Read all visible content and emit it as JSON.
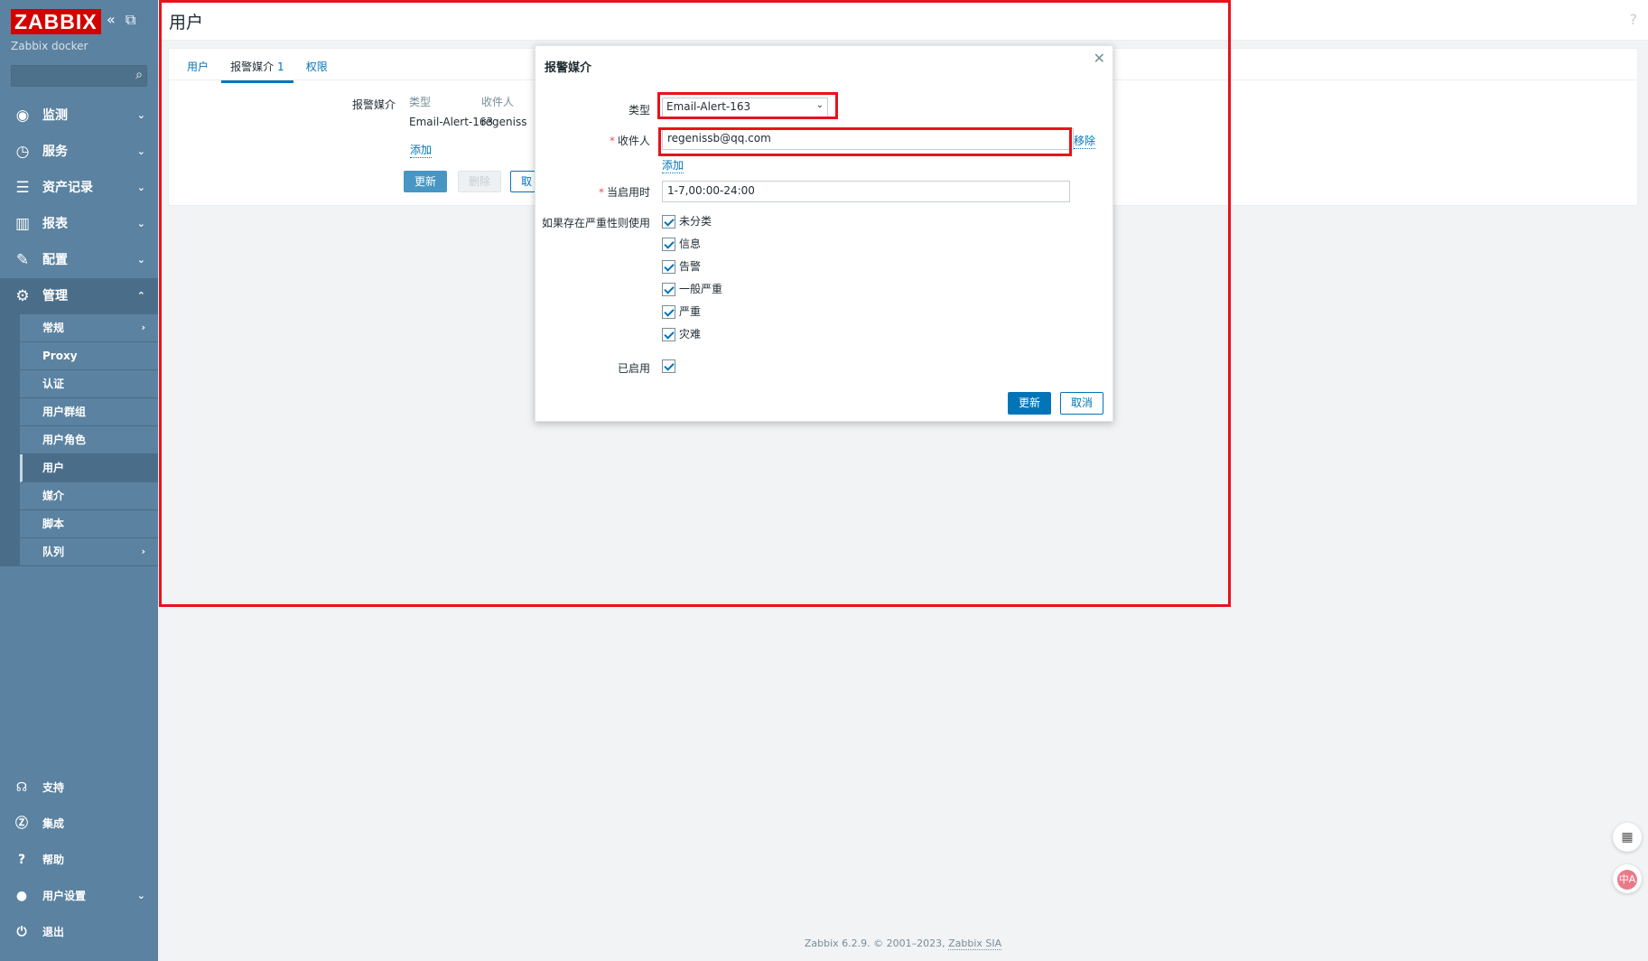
{
  "sidebar": {
    "logo": "ZABBIX",
    "instance": "Zabbix docker",
    "menu": [
      {
        "label": "监测",
        "icon": "eye-icon"
      },
      {
        "label": "服务",
        "icon": "stopwatch-icon"
      },
      {
        "label": "资产记录",
        "icon": "list-icon"
      },
      {
        "label": "报表",
        "icon": "bar-chart-icon"
      },
      {
        "label": "配置",
        "icon": "wrench-icon"
      },
      {
        "label": "管理",
        "icon": "gear-icon"
      }
    ],
    "submenu": [
      "常规",
      "Proxy",
      "认证",
      "用户群组",
      "用户角色",
      "用户",
      "媒介",
      "脚本",
      "队列"
    ],
    "bottom": [
      {
        "label": "支持",
        "icon": "headset-icon"
      },
      {
        "label": "集成",
        "icon": "zabbix-z-icon"
      },
      {
        "label": "帮助",
        "icon": "question-icon"
      },
      {
        "label": "用户设置",
        "icon": "user-icon"
      },
      {
        "label": "退出",
        "icon": "power-icon"
      }
    ]
  },
  "header": {
    "title": "用户",
    "help": "?"
  },
  "tabs": [
    {
      "label": "用户"
    },
    {
      "label": "报警媒介",
      "badge": "1"
    },
    {
      "label": "权限"
    }
  ],
  "media": {
    "label": "报警媒介",
    "col_type": "类型",
    "col_recipient": "收件人",
    "row_type": "Email-Alert-163",
    "row_recipient": "regeniss",
    "add": "添加",
    "btn_update": "更新",
    "btn_delete": "删除",
    "btn_cancel": "取消"
  },
  "modal": {
    "title": "报警媒介",
    "type_label": "类型",
    "type_value": "Email-Alert-163",
    "recipient_label": "收件人",
    "recipient_value": "regenissb@qq.com",
    "remove": "移除",
    "add": "添加",
    "when_active_label": "当启用时",
    "when_active_value": "1-7,00:00-24:00",
    "severity_label": "如果存在严重性则使用",
    "severities": [
      "未分类",
      "信息",
      "告警",
      "一般严重",
      "严重",
      "灾难"
    ],
    "enabled_label": "已启用",
    "btn_update": "更新",
    "btn_cancel": "取消"
  },
  "footer": {
    "text": "Zabbix 6.2.9. © 2001–2023, ",
    "company": "Zabbix SIA"
  },
  "floating": {
    "translate": "中A"
  }
}
